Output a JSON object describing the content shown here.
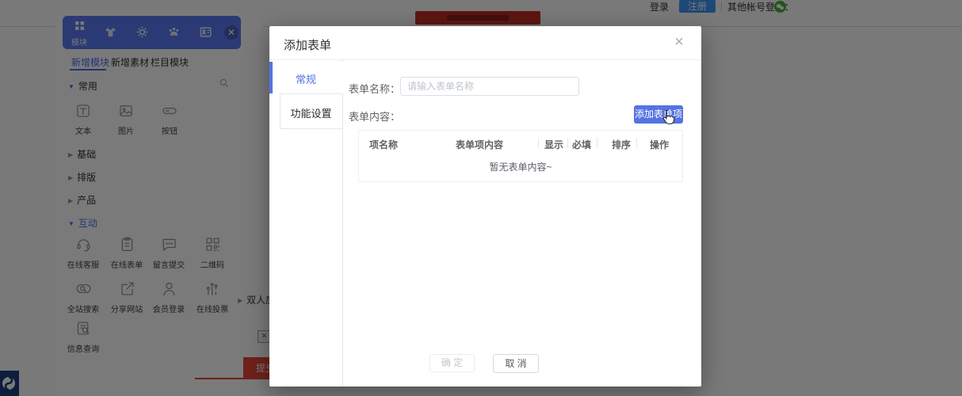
{
  "page": {
    "topbar": {
      "login_label": "登录",
      "register_label": "注册",
      "other_login_label": "其他帐号登录：",
      "wechat_icon": "wechat-icon",
      "banner_color": "#c22f26"
    },
    "panel": {
      "toolbar": {
        "module_label": "模块",
        "icons": [
          "modules-grid-icon",
          "theme-shirt-icon",
          "settings-gear-icon",
          "paw-icon",
          "member-card-icon",
          "close-icon"
        ],
        "color": "#5b79f2"
      },
      "tabs": [
        {
          "label": "新增模块",
          "active": true
        },
        {
          "label": "新增素材",
          "active": false
        },
        {
          "label": "栏目模块",
          "active": false
        }
      ],
      "sections": [
        {
          "label": "常用",
          "expanded": true,
          "items": [
            {
              "label": "文本",
              "icon": "text-module-icon"
            },
            {
              "label": "图片",
              "icon": "image-module-icon"
            },
            {
              "label": "按钮",
              "icon": "button-module-icon"
            }
          ]
        },
        {
          "label": "基础",
          "expanded": false
        },
        {
          "label": "排版",
          "expanded": false
        },
        {
          "label": "产品",
          "expanded": false
        },
        {
          "label": "互动",
          "expanded": true,
          "items": [
            {
              "label": "在线客服",
              "icon": "headset-icon"
            },
            {
              "label": "在线表单",
              "icon": "clipboard-icon"
            },
            {
              "label": "留言提交",
              "icon": "comment-icon"
            },
            {
              "label": "二维码",
              "icon": "qrcode-icon"
            },
            {
              "label": "全站搜索",
              "icon": "site-search-icon"
            },
            {
              "label": "分享网站",
              "icon": "share-icon"
            },
            {
              "label": "会员登录",
              "icon": "member-icon"
            },
            {
              "label": "在线投票",
              "icon": "vote-chart-icon"
            },
            {
              "label": "信息查询",
              "icon": "info-query-icon"
            }
          ]
        }
      ]
    },
    "canvas": {
      "room_label": "双人房",
      "submit_label": "提交",
      "accent_red": "#e8453a",
      "logo_navy": "#1d3e7d"
    }
  },
  "modal": {
    "title": "添加表单",
    "close_icon": "×",
    "tabs": [
      {
        "label": "常规",
        "active": true
      },
      {
        "label": "功能设置",
        "active": false
      }
    ],
    "form": {
      "name_label": "表单名称：",
      "name_placeholder": "请输入表单名称",
      "content_label": "表单内容：",
      "add_item_button": "添加表单项"
    },
    "table": {
      "headers": [
        "项名称",
        "表单项内容",
        "显示",
        "必填",
        "排序",
        "操作"
      ],
      "empty_text": "暂无表单内容~",
      "rows": []
    },
    "footer": {
      "confirm": "确 定",
      "cancel": "取 消"
    },
    "accent_blue": "#5573e2"
  }
}
